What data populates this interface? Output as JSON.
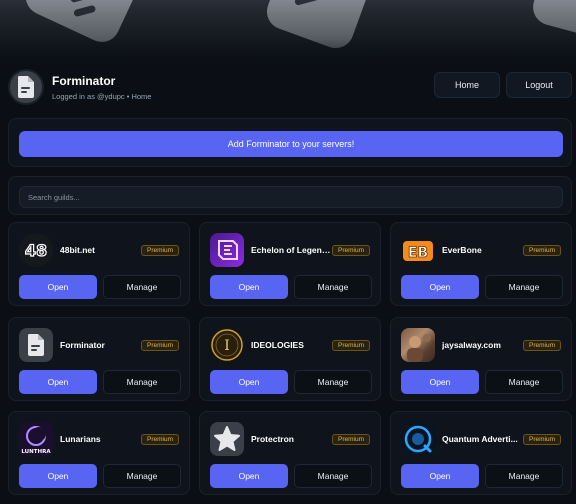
{
  "app": {
    "title": "Forminator",
    "subtitle": "Logged in as @ydupc • Home"
  },
  "nav": {
    "home_label": "Home",
    "logout_label": "Logout"
  },
  "actions": {
    "add_label": "Add Forminator to your servers!"
  },
  "search": {
    "placeholder": "Search guilds..."
  },
  "card_actions": {
    "open_label": "Open",
    "manage_label": "Manage"
  },
  "colors": {
    "accent": "#5865f2",
    "premium_text": "#e0b64a",
    "background": "#0b0f15"
  },
  "guilds": [
    {
      "name": "48bit.net",
      "badge": "Premium",
      "icon": "48-icon"
    },
    {
      "name": "Echelon of Legends",
      "badge": "Premium",
      "icon": "echelon-logo-icon"
    },
    {
      "name": "EverBone",
      "badge": "Premium",
      "icon": "eb-logo-icon"
    },
    {
      "name": "Forminator",
      "badge": "Premium",
      "icon": "document-icon"
    },
    {
      "name": "IDEOLOGIES",
      "badge": "Premium",
      "icon": "ideologies-logo-icon"
    },
    {
      "name": "jaysalway.com",
      "badge": "Premium",
      "icon": "photo-avatar-icon"
    },
    {
      "name": "Lunarians",
      "badge": "Premium",
      "icon": "lunthra-logo-icon",
      "icon_text": "LUNTHRA"
    },
    {
      "name": "Protectron",
      "badge": "Premium",
      "icon": "star-icon"
    },
    {
      "name": "Quantum Adverti...",
      "badge": "Premium",
      "icon": "quantum-logo-icon"
    }
  ]
}
